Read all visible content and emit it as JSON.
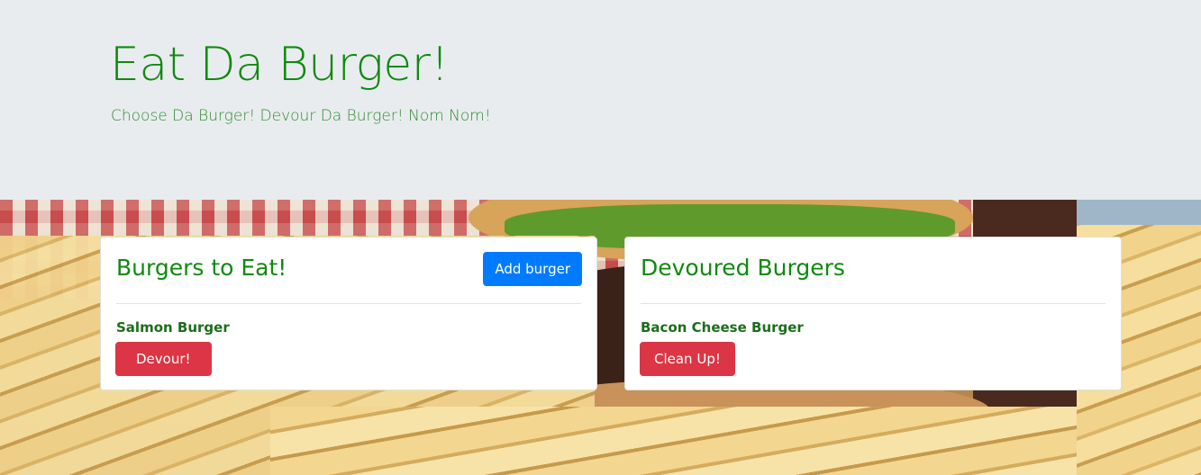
{
  "header": {
    "title": "Eat Da Burger!",
    "subtitle": "Choose Da Burger! Devour Da Burger! Nom Nom!"
  },
  "to_eat": {
    "title": "Burgers to Eat!",
    "add_button_label": "Add burger",
    "items": [
      {
        "name": "Salmon Burger",
        "action_label": "Devour!"
      }
    ]
  },
  "devoured": {
    "title": "Devoured Burgers",
    "items": [
      {
        "name": "Bacon Cheese Burger",
        "action_label": "Clean Up!"
      }
    ]
  },
  "colors": {
    "heading_green": "#0f8a0f",
    "primary_button": "#007bff",
    "danger_button": "#dc3545",
    "jumbotron_bg": "#e9ecef"
  },
  "background_image": "burger-and-fries-photo"
}
